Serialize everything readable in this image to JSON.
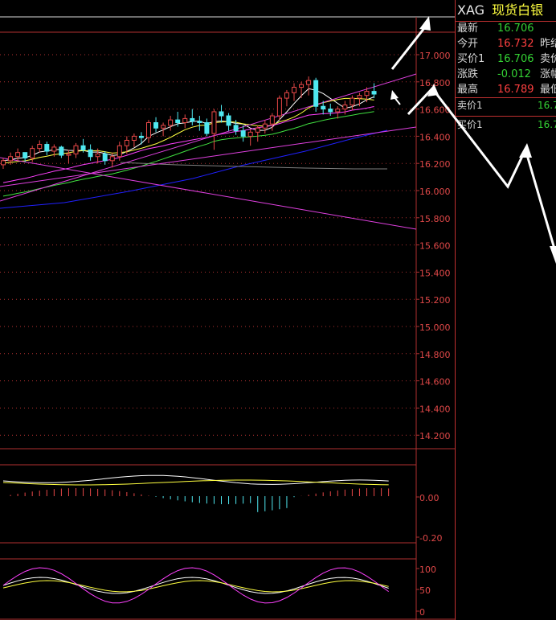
{
  "colors": {
    "up": "#e84848",
    "down": "#4fe8f0",
    "grid": "#b03030",
    "axis_text": "#e04848",
    "ma5": "#ffffff",
    "ma10": "#ffff40",
    "ma20": "#ff40ff",
    "ma30": "#40e040",
    "ma60": "#2020ff",
    "ma120": "#808080",
    "trendline": "#e040e0",
    "arrow": "#ffffff",
    "green_price": "#34d234",
    "red_price": "#ff4040"
  },
  "quote": {
    "code": "XAG",
    "name": "现货白银",
    "rows": [
      {
        "label": "最新",
        "value": "16.706",
        "color": "green",
        "label2": ""
      },
      {
        "label": "今开",
        "value": "16.732",
        "color": "red",
        "label2": "昨结"
      },
      {
        "label": "买价1",
        "value": "16.706",
        "color": "green",
        "label2": "卖价"
      },
      {
        "label": "涨跌",
        "value": "-0.012",
        "color": "green",
        "label2": "涨幅"
      },
      {
        "label": "最高",
        "value": "16.789",
        "color": "red",
        "label2": "最低"
      }
    ],
    "order_book": [
      {
        "label": "卖价1",
        "value": "16.7"
      },
      {
        "label": "买价1",
        "value": "16.7"
      }
    ]
  },
  "main_axis": {
    "ticks": [
      "17.000",
      "16.800",
      "16.600",
      "16.400",
      "16.200",
      "16.000",
      "15.800",
      "15.600",
      "15.400",
      "15.200",
      "15.000",
      "14.800",
      "14.600",
      "14.400",
      "14.200"
    ]
  },
  "macd_axis": {
    "ticks": [
      "0.00",
      "-0.20"
    ]
  },
  "kdj_axis": {
    "ticks": [
      "100",
      "50",
      "0"
    ]
  },
  "chart_data": {
    "type": "candlestick",
    "title": "",
    "ylim": [
      14.15,
      17.12
    ],
    "ma_periods": [
      5,
      10,
      20,
      30,
      60,
      120
    ],
    "candles_ohlc": [
      [
        16.19,
        16.24,
        16.16,
        16.22
      ],
      [
        16.22,
        16.28,
        16.19,
        16.25
      ],
      [
        16.25,
        16.31,
        16.22,
        16.28
      ],
      [
        16.28,
        16.26,
        16.21,
        16.24
      ],
      [
        16.24,
        16.33,
        16.21,
        16.31
      ],
      [
        16.31,
        16.37,
        16.28,
        16.34
      ],
      [
        16.34,
        16.36,
        16.26,
        16.29
      ],
      [
        16.29,
        16.34,
        16.25,
        16.32
      ],
      [
        16.32,
        16.33,
        16.24,
        16.26
      ],
      [
        16.26,
        16.3,
        16.2,
        16.27
      ],
      [
        16.27,
        16.35,
        16.24,
        16.33
      ],
      [
        16.33,
        16.38,
        16.28,
        16.3
      ],
      [
        16.3,
        16.34,
        16.22,
        16.25
      ],
      [
        16.25,
        16.31,
        16.2,
        16.27
      ],
      [
        16.27,
        16.29,
        16.19,
        16.22
      ],
      [
        16.22,
        16.28,
        16.17,
        16.25
      ],
      [
        16.25,
        16.36,
        16.22,
        16.33
      ],
      [
        16.33,
        16.4,
        16.27,
        16.37
      ],
      [
        16.37,
        16.42,
        16.32,
        16.4
      ],
      [
        16.4,
        16.43,
        16.34,
        16.39
      ],
      [
        16.39,
        16.52,
        16.35,
        16.5
      ],
      [
        16.5,
        16.54,
        16.43,
        16.46
      ],
      [
        16.46,
        16.5,
        16.4,
        16.48
      ],
      [
        16.48,
        16.55,
        16.44,
        16.52
      ],
      [
        16.52,
        16.58,
        16.47,
        16.5
      ],
      [
        16.5,
        16.56,
        16.46,
        16.53
      ],
      [
        16.53,
        16.6,
        16.48,
        16.51
      ],
      [
        16.51,
        16.55,
        16.44,
        16.5
      ],
      [
        16.5,
        16.53,
        16.4,
        16.42
      ],
      [
        16.42,
        16.6,
        16.3,
        16.58
      ],
      [
        16.58,
        16.63,
        16.5,
        16.55
      ],
      [
        16.55,
        16.57,
        16.44,
        16.48
      ],
      [
        16.48,
        16.52,
        16.41,
        16.44
      ],
      [
        16.44,
        16.48,
        16.36,
        16.4
      ],
      [
        16.4,
        16.45,
        16.33,
        16.43
      ],
      [
        16.43,
        16.48,
        16.36,
        16.46
      ],
      [
        16.46,
        16.52,
        16.42,
        16.49
      ],
      [
        16.49,
        16.57,
        16.44,
        16.55
      ],
      [
        16.55,
        16.7,
        16.52,
        16.68
      ],
      [
        16.68,
        16.74,
        16.62,
        16.72
      ],
      [
        16.72,
        16.79,
        16.66,
        16.76
      ],
      [
        16.76,
        16.8,
        16.68,
        16.78
      ],
      [
        16.78,
        16.84,
        16.7,
        16.81
      ],
      [
        16.81,
        16.83,
        16.58,
        16.62
      ],
      [
        16.62,
        16.66,
        16.56,
        16.6
      ],
      [
        16.6,
        16.64,
        16.55,
        16.58
      ],
      [
        16.58,
        16.62,
        16.53,
        16.6
      ],
      [
        16.6,
        16.66,
        16.56,
        16.63
      ],
      [
        16.63,
        16.7,
        16.59,
        16.68
      ],
      [
        16.68,
        16.72,
        16.62,
        16.7
      ],
      [
        16.7,
        16.76,
        16.65,
        16.73
      ],
      [
        16.73,
        16.79,
        16.68,
        16.71
      ]
    ]
  }
}
